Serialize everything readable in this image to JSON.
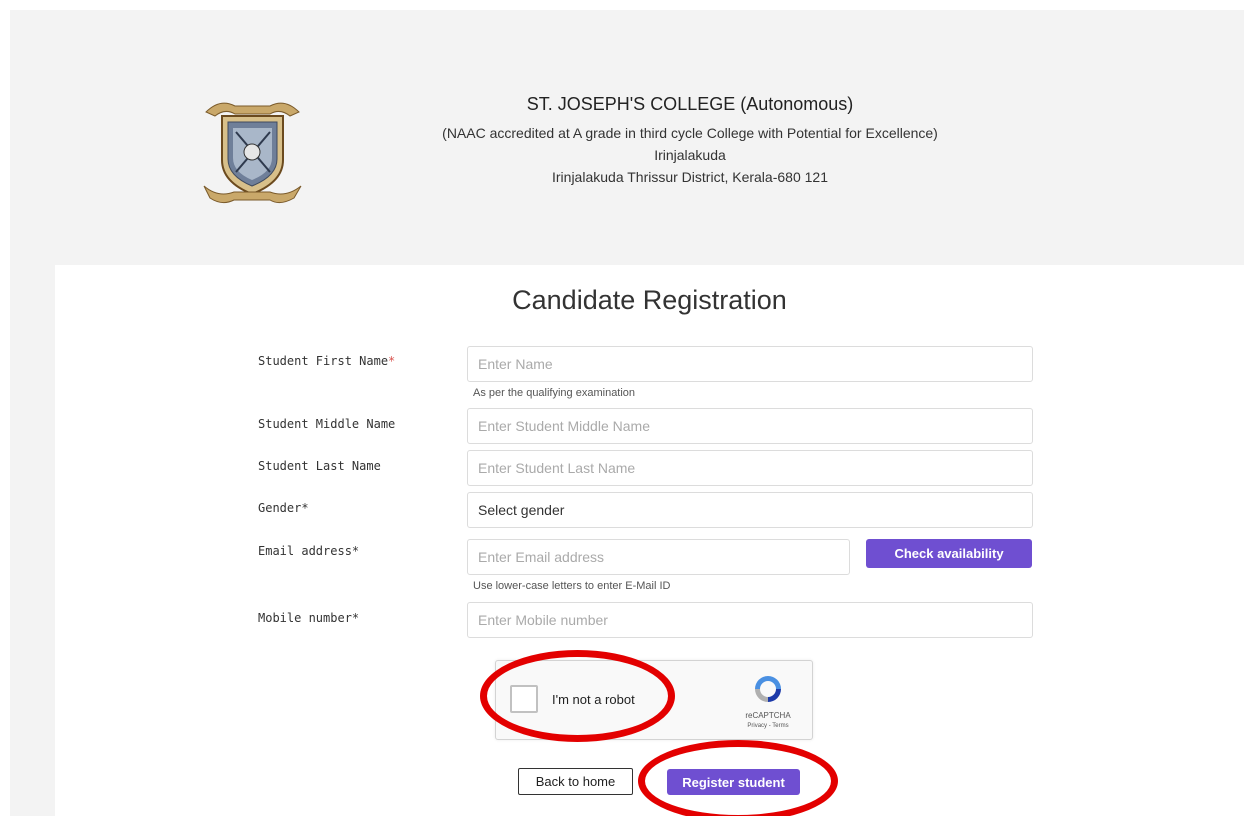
{
  "header": {
    "college_name": "ST. JOSEPH'S COLLEGE (Autonomous)",
    "accreditation": "(NAAC accredited at A grade in third cycle College with Potential for Excellence)",
    "town": "Irinjalakuda",
    "address": "Irinjalakuda Thrissur District, Kerala-680 121"
  },
  "form": {
    "title": "Candidate Registration",
    "first_name": {
      "label": "Student First Name",
      "required_mark": "*",
      "placeholder": "Enter Name",
      "hint": "As per the qualifying examination"
    },
    "middle_name": {
      "label": "Student Middle Name",
      "placeholder": "Enter Student Middle Name"
    },
    "last_name": {
      "label": "Student Last Name",
      "placeholder": "Enter Student Last Name"
    },
    "gender": {
      "label": "Gender*",
      "selected": "Select gender"
    },
    "email": {
      "label": "Email address*",
      "placeholder": "Enter Email address",
      "hint": "Use lower-case letters to enter E-Mail ID",
      "check_button": "Check availability"
    },
    "mobile": {
      "label": "Mobile number*",
      "placeholder": "Enter Mobile number"
    },
    "recaptcha": {
      "label": "I'm not a robot",
      "brand": "reCAPTCHA",
      "links": "Privacy - Terms"
    },
    "back_button": "Back to home",
    "register_button": "Register student"
  },
  "colors": {
    "primary": "#6f4fd1",
    "annotation": "#e30000",
    "required": "#d9534f"
  }
}
